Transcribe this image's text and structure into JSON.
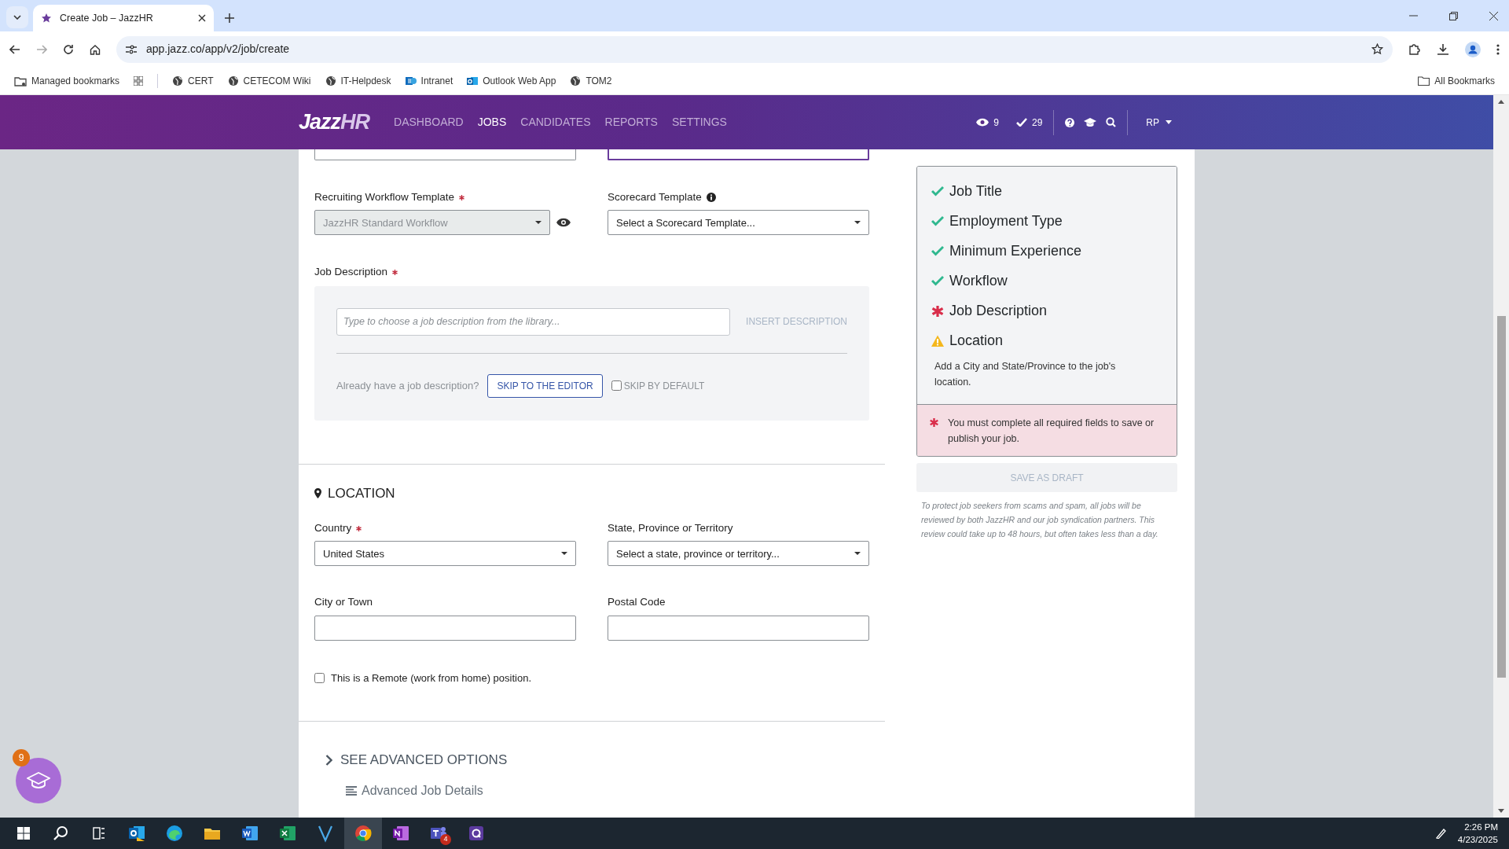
{
  "browser": {
    "tabs": [
      {
        "title": "Create Job – JazzHR",
        "selected": true
      }
    ],
    "url": "app.jazz.co/app/v2/job/create",
    "bookmarks": [
      {
        "label": "Managed bookmarks",
        "kind": "managed"
      },
      {
        "label": "CERT",
        "kind": "globe"
      },
      {
        "label": "CETECOM Wiki",
        "kind": "globe"
      },
      {
        "label": "IT-Helpdesk",
        "kind": "globe"
      },
      {
        "label": "Intranet",
        "kind": "sharepoint"
      },
      {
        "label": "Outlook Web App",
        "kind": "outlook"
      },
      {
        "label": "TOM2",
        "kind": "globe"
      }
    ],
    "all_bookmarks": "All Bookmarks"
  },
  "navbar": {
    "logo_main": "Jazz",
    "logo_accent": "HR",
    "links": [
      {
        "label": "DASHBOARD",
        "selected": false
      },
      {
        "label": "JOBS",
        "selected": true
      },
      {
        "label": "CANDIDATES",
        "selected": false
      },
      {
        "label": "REPORTS",
        "selected": false
      },
      {
        "label": "SETTINGS",
        "selected": false
      }
    ],
    "views": "9",
    "tasks": "29",
    "user": "RP"
  },
  "form": {
    "workflow": {
      "label": "Recruiting Workflow Template",
      "required": true,
      "value": "JazzHR Standard Workflow",
      "disabled": true
    },
    "scorecard": {
      "label": "Scorecard Template",
      "required": false,
      "value": "Select a Scorecard Template..."
    },
    "description": {
      "label": "Job Description",
      "required": true,
      "placeholder": "Type to choose a job description from the library...",
      "insert": "INSERT DESCRIPTION",
      "prompt": "Already have a job description?",
      "skip_button": "SKIP TO THE EDITOR",
      "skip_default": {
        "label": "SKIP BY DEFAULT",
        "checked": false
      }
    },
    "location": {
      "heading": "LOCATION",
      "fields": [
        {
          "label": "Country",
          "required": true,
          "kind": "select",
          "value": "United States"
        },
        {
          "label": "State, Province or Territory",
          "required": false,
          "kind": "select",
          "value": "Select a state, province or territory..."
        },
        {
          "label": "City or Town",
          "required": false,
          "kind": "text"
        },
        {
          "label": "Postal Code",
          "required": false,
          "kind": "text"
        }
      ],
      "remote": {
        "label": "This is a Remote (work from home) position.",
        "checked": false
      }
    },
    "advanced": {
      "toggle": "SEE ADVANCED OPTIONS",
      "expanded": false,
      "items": [
        "Advanced Job Details"
      ]
    }
  },
  "checklist": {
    "items": [
      {
        "label": "Job Title",
        "kind": "done"
      },
      {
        "label": "Employment Type",
        "kind": "done"
      },
      {
        "label": "Minimum Experience",
        "kind": "done"
      },
      {
        "label": "Workflow",
        "kind": "done"
      },
      {
        "label": "Job Description",
        "kind": "missing"
      },
      {
        "label": "Location",
        "kind": "warning"
      }
    ],
    "hint": "Add a City and State/Province to the job's location.",
    "error": "You must complete all required fields to save or publish your job.",
    "save_button": {
      "label": "SAVE AS DRAFT",
      "disabled": true
    },
    "note": "To protect job seekers from scams and spam, all jobs will be reviewed by both JazzHR and our job syndication partners. This review could take up to 48 hours, but often takes less than a day."
  },
  "help_button": {
    "badge": "9"
  },
  "taskbar": {
    "apps": [
      {
        "kind": "outlook",
        "selected": false
      },
      {
        "kind": "edge",
        "selected": false
      },
      {
        "kind": "explorer",
        "selected": false
      },
      {
        "kind": "word",
        "selected": false
      },
      {
        "kind": "excel",
        "selected": false
      },
      {
        "kind": "v",
        "selected": false
      },
      {
        "kind": "chrome",
        "selected": true
      },
      {
        "kind": "onenote",
        "selected": false
      },
      {
        "kind": "teams",
        "selected": false,
        "badge": "4"
      },
      {
        "kind": "q",
        "selected": false
      }
    ],
    "time": "2:26 PM",
    "date": "4/23/2025"
  }
}
